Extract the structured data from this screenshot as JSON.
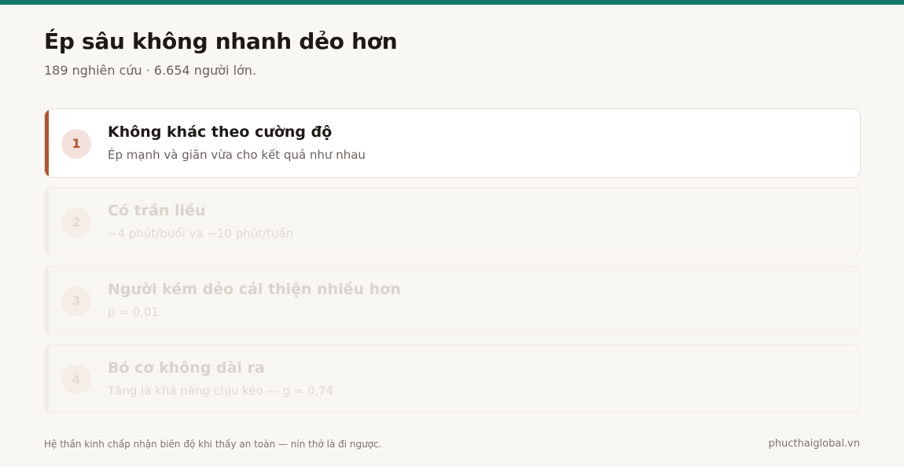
{
  "colors": {
    "top_bar": "#127868",
    "accent": "#b4532f",
    "background": "#f9f7f4"
  },
  "header": {
    "title": "Ép sâu không nhanh dẻo hơn",
    "subtitle": "189 nghiên cứu · 6.654 người lớn."
  },
  "cards": [
    {
      "number": "1",
      "heading": "Không khác theo cường độ",
      "desc": "Ép mạnh và giãn vừa cho kết quả như nhau",
      "active": true
    },
    {
      "number": "2",
      "heading": "Có trần liều",
      "desc": "~4 phút/buổi và ~10 phút/tuần",
      "active": false
    },
    {
      "number": "3",
      "heading": "Người kém dẻo cải thiện nhiều hơn",
      "desc": "p = 0,01",
      "active": false
    },
    {
      "number": "4",
      "heading": "Bó cơ không dài ra",
      "desc": "Tăng là khả năng chịu kéo — g = 0,74",
      "active": false
    }
  ],
  "footer": {
    "note": "Hệ thần kinh chấp nhận biên độ khi thấy an toàn — nín thở là đi ngược.",
    "site": "phucthaiglobal.vn"
  }
}
